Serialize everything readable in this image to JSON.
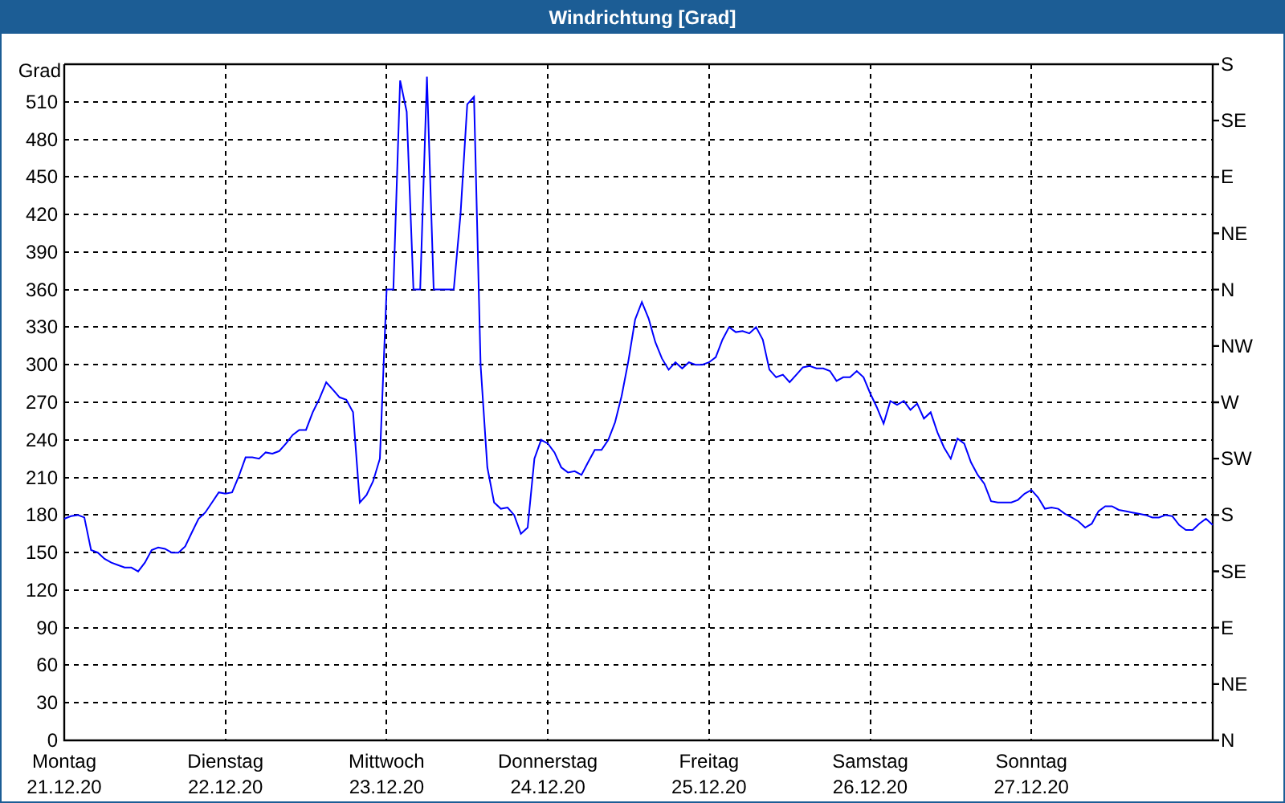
{
  "window": {
    "title": "Windrichtung [Grad]"
  },
  "chart": {
    "chart_data": {
      "type": "line",
      "ylabel": "Grad",
      "categories": [
        "Montag\n21.12.20",
        null,
        null,
        null,
        null,
        null,
        null,
        null,
        null,
        null,
        null,
        null,
        null,
        null,
        null,
        null,
        null,
        null,
        null,
        null,
        null,
        null,
        null,
        null,
        "Dienstag\n22.12.20",
        null,
        null,
        null,
        null,
        null,
        null,
        null,
        null,
        null,
        null,
        null,
        null,
        null,
        null,
        null,
        null,
        null,
        null,
        null,
        null,
        null,
        null,
        null,
        "Mittwoch\n23.12.20",
        null,
        null,
        null,
        null,
        null,
        null,
        null,
        null,
        null,
        null,
        null,
        null,
        null,
        null,
        null,
        null,
        null,
        null,
        null,
        null,
        null,
        null,
        null,
        "Donnerstag\n24.12.20",
        null,
        null,
        null,
        null,
        null,
        null,
        null,
        null,
        null,
        null,
        null,
        null,
        null,
        null,
        null,
        null,
        null,
        null,
        null,
        null,
        null,
        null,
        null,
        "Freitag\n25.12.20",
        null,
        null,
        null,
        null,
        null,
        null,
        null,
        null,
        null,
        null,
        null,
        null,
        null,
        null,
        null,
        null,
        null,
        null,
        null,
        null,
        null,
        null,
        null,
        "Samstag\n26.12.20",
        null,
        null,
        null,
        null,
        null,
        null,
        null,
        null,
        null,
        null,
        null,
        null,
        null,
        null,
        null,
        null,
        null,
        null,
        null,
        null,
        null,
        null,
        null,
        "Sonntag\n27.12.20",
        null,
        null,
        null,
        null,
        null,
        null,
        null,
        null,
        null,
        null,
        null,
        null,
        null,
        null,
        null,
        null,
        null,
        null,
        null,
        null,
        null,
        null,
        null,
        null,
        null,
        null,
        null
      ],
      "ylim": [
        0,
        540
      ],
      "grid": true,
      "yticks": [
        0,
        30,
        60,
        90,
        120,
        150,
        180,
        210,
        240,
        270,
        300,
        330,
        360,
        390,
        420,
        450,
        480,
        510
      ],
      "series": [
        {
          "color": "#0000ff",
          "values": [
            177,
            179,
            180,
            178,
            152,
            150,
            145,
            142,
            140,
            138,
            138,
            135,
            142,
            152,
            154,
            153,
            150,
            150,
            155,
            166,
            177,
            182,
            190,
            198,
            197,
            198,
            211,
            226,
            226,
            225,
            230,
            229,
            231,
            237,
            244,
            248,
            248,
            262,
            273,
            286,
            280,
            274,
            272,
            262,
            190,
            196,
            207,
            225,
            360,
            360,
            527,
            502,
            360,
            360,
            530,
            360,
            360,
            360,
            360,
            420,
            508,
            514,
            300,
            218,
            190,
            185,
            186,
            180,
            165,
            170,
            225,
            240,
            237,
            230,
            218,
            214,
            215,
            212,
            222,
            232,
            232,
            240,
            254,
            275,
            303,
            336,
            350,
            337,
            318,
            305,
            296,
            302,
            297,
            302,
            300,
            300,
            302,
            306,
            320,
            330,
            326,
            327,
            325,
            330,
            320,
            296,
            290,
            292,
            286,
            292,
            298,
            299,
            297,
            297,
            295,
            287,
            290,
            290,
            295,
            290,
            277,
            266,
            253,
            271,
            268,
            271,
            264,
            269,
            257,
            262,
            246,
            234,
            225,
            241,
            237,
            222,
            212,
            205,
            191,
            190,
            190,
            190,
            192,
            197,
            200,
            194,
            185,
            186,
            185,
            181,
            178,
            175,
            170,
            173,
            183,
            187,
            187,
            184,
            183,
            182,
            181,
            180,
            178,
            178,
            180,
            179,
            172,
            168,
            168,
            173,
            177,
            172
          ]
        }
      ]
    },
    "compass_axis": {
      "labels": [
        "S",
        "SE",
        "E",
        "NE",
        "N",
        "NW",
        "W",
        "SW",
        "S",
        "SE",
        "E",
        "NE",
        "N"
      ]
    }
  }
}
